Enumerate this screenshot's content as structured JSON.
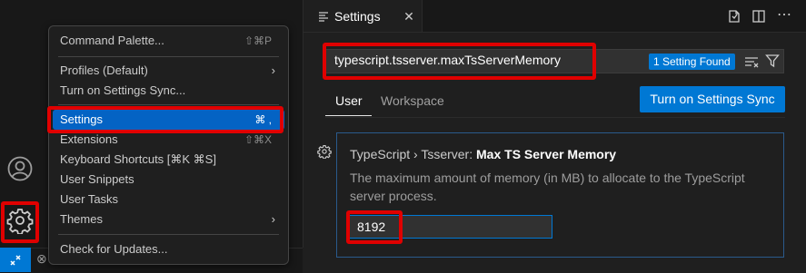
{
  "menu": {
    "items": [
      {
        "label": "Command Palette...",
        "shortcut": "⇧⌘P"
      },
      {
        "label": "Profiles (Default)"
      },
      {
        "label": "Turn on Settings Sync..."
      },
      {
        "label": "Settings",
        "shortcut": "⌘ ,"
      },
      {
        "label": "Extensions",
        "shortcut": "⇧⌘X"
      },
      {
        "label": "Keyboard Shortcuts [⌘K ⌘S]"
      },
      {
        "label": "User Snippets"
      },
      {
        "label": "User Tasks"
      },
      {
        "label": "Themes"
      },
      {
        "label": "Check for Updates..."
      }
    ]
  },
  "editor": {
    "tab_title": "Settings",
    "search_value": "typescript.tsserver.maxTsServerMemory",
    "results_badge": "1 Setting Found",
    "scope_tabs": [
      "User",
      "Workspace"
    ],
    "sync_button": "Turn on Settings Sync"
  },
  "setting": {
    "category": "TypeScript › Tsserver: ",
    "name": "Max TS Server Memory",
    "description": "The maximum amount of memory (in MB) to allocate to the TypeScript server process.",
    "value": "8192"
  },
  "colors": {
    "accent": "#0078d4",
    "highlight": "#e00000",
    "menu_active": "#0463c4"
  }
}
